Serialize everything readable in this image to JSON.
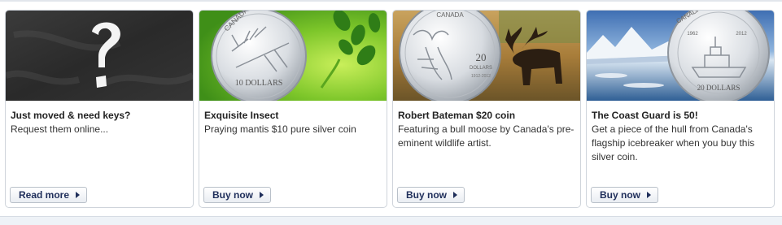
{
  "cards": [
    {
      "title": "Just moved & need keys?",
      "description": "Request them online...",
      "button_label": "Read more"
    },
    {
      "title": "Exquisite Insect",
      "description": "Praying mantis $10 pure silver coin",
      "button_label": "Buy now",
      "coin_text": "10 DOLLARS",
      "coin_country": "CANADA"
    },
    {
      "title": "Robert Bateman $20 coin",
      "description": "Featuring a bull moose by Canada's pre-eminent wildlife artist.",
      "button_label": "Buy now",
      "coin_country": "CANADA",
      "coin_value": "20",
      "coin_unit": "DOLLARS",
      "coin_years": "1912-2012"
    },
    {
      "title": "The Coast Guard is 50!",
      "description": "Get a piece of the hull from Canada's flagship icebreaker when you buy this silver coin.",
      "button_label": "Buy now",
      "coin_country": "CANADA",
      "coin_text": "20 DOLLARS",
      "coin_years_left": "1962",
      "coin_years_right": "2012"
    }
  ],
  "colors": {
    "button_text": "#1f2e5a",
    "card_border": "#cfd4db"
  }
}
